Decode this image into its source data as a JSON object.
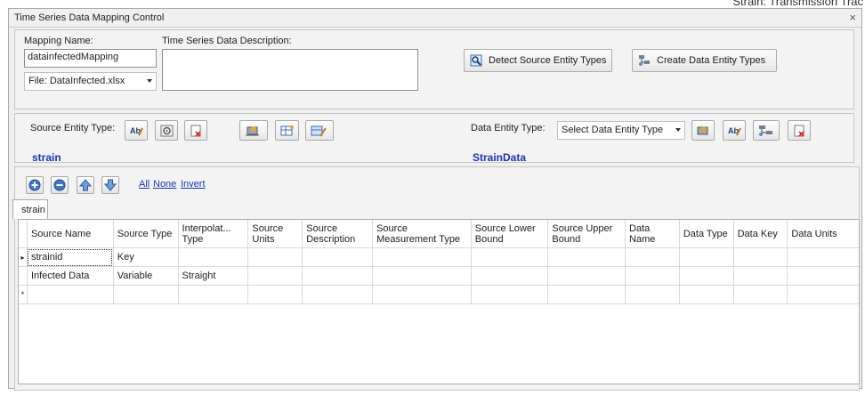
{
  "window": {
    "title": "Time Series Data Mapping Control",
    "close_glyph": "×"
  },
  "background": {
    "top_text": "Strain: Transmission Trac"
  },
  "mapping": {
    "name_label": "Mapping Name:",
    "name_value": "datainfectedMapping",
    "file_value": "File: DataInfected.xlsx",
    "description_label": "Time Series Data Description:",
    "description_value": ""
  },
  "buttons": {
    "detect_label": "Detect Source Entity Types",
    "create_label": "Create Data Entity Types"
  },
  "source": {
    "label": "Source Entity Type:",
    "entity": "strain"
  },
  "data_entity": {
    "label": "Data Entity Type:",
    "select_value": "Select Data Entity Type",
    "entity": "StrainData"
  },
  "links": {
    "all": "All",
    "none": "None",
    "invert": "Invert"
  },
  "tab": {
    "label": "strain"
  },
  "grid": {
    "columns": [
      "Source Name",
      "Source Type",
      "Interpolat... Type",
      "Source Units",
      "Source Description",
      "Source Measurement Type",
      "Source Lower Bound",
      "Source Upper Bound",
      "Data Name",
      "Data Type",
      "Data Key",
      "Data Units"
    ],
    "rows": [
      {
        "marker": "▸",
        "cells": [
          "strainid",
          "Key",
          "",
          "",
          "",
          "",
          "",
          "",
          "",
          "",
          "",
          ""
        ]
      },
      {
        "marker": "",
        "cells": [
          "Infected Data",
          "Variable",
          "Straight",
          "",
          "",
          "",
          "",
          "",
          "",
          "",
          "",
          ""
        ]
      },
      {
        "marker": "*",
        "cells": [
          "",
          "",
          "",
          "",
          "",
          "",
          "",
          "",
          "",
          "",
          "",
          ""
        ]
      }
    ]
  },
  "colors": {
    "entity_text": "#1a35b5",
    "link": "#1a35b5"
  }
}
